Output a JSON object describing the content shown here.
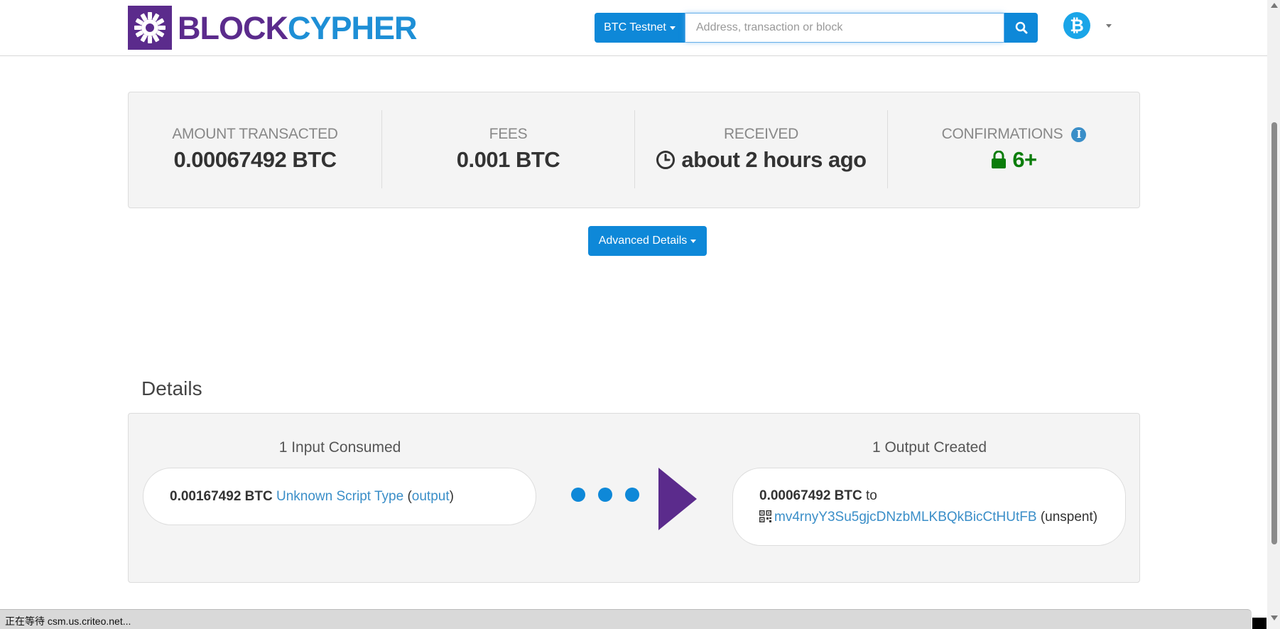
{
  "brand": {
    "name_part1": "BLOCK",
    "name_part2": "CYPHER",
    "colors": {
      "purple": "#5b2b8c",
      "blue": "#1e8fd6"
    }
  },
  "search": {
    "network_label": "BTC Testnet",
    "placeholder": "Address, transaction or block",
    "value": "",
    "button_icon": "search-icon"
  },
  "coin_menu": {
    "icon": "bitcoin-icon",
    "glyph": "₿"
  },
  "summary": {
    "amount_transacted": {
      "label": "AMOUNT TRANSACTED",
      "value": "0.00067492 BTC"
    },
    "fees": {
      "label": "FEES",
      "value": "0.001 BTC"
    },
    "received": {
      "label": "RECEIVED",
      "value": "about 2 hours ago",
      "icon": "clock-icon"
    },
    "confirmations": {
      "label": "CONFIRMATIONS",
      "value": "6+",
      "icon": "lock-icon",
      "info_icon": "info-icon",
      "color": "#0a7d0a"
    }
  },
  "advanced_details_label": "Advanced Details",
  "details": {
    "heading": "Details",
    "inputs_title": "1 Input Consumed",
    "outputs_title": "1 Output Created",
    "input": {
      "amount": "0.00167492 BTC",
      "script_type": "Unknown Script Type",
      "paren_open": "(",
      "output_link": "output",
      "paren_close": ")"
    },
    "output": {
      "amount": "0.00067492 BTC",
      "to": "to",
      "address": "mv4rnyY3Su5gjcDNzbMLKBQkBicCtHUtFB",
      "status": "(unspent)",
      "qr_icon": "qr-code-icon"
    }
  },
  "status_bar": {
    "text": "正在等待 csm.us.criteo.net..."
  }
}
